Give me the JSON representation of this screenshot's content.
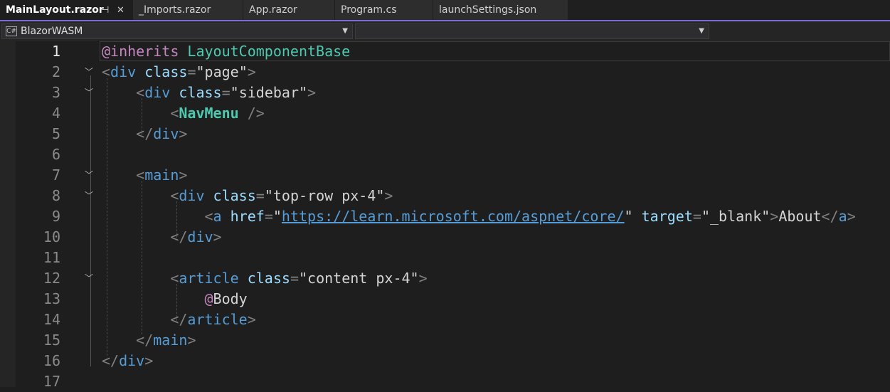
{
  "tabs": [
    {
      "label": "MainLayout.razor",
      "active": true
    },
    {
      "label": "_Imports.razor",
      "active": false
    },
    {
      "label": "App.razor",
      "active": false
    },
    {
      "label": "Program.cs",
      "active": false
    },
    {
      "label": "launchSettings.json",
      "active": false
    }
  ],
  "tab_icons": {
    "pin": "⊣",
    "close": "✕"
  },
  "navbar": {
    "project": "BlazorWASM",
    "project_icon": "C#",
    "member": ""
  },
  "editor": {
    "current_line": 1,
    "line_numbers": [
      "1",
      "2",
      "3",
      "4",
      "5",
      "6",
      "7",
      "8",
      "9",
      "10",
      "11",
      "12",
      "13",
      "14",
      "15",
      "16",
      "17"
    ],
    "lines": {
      "l1": {
        "directive": "@inherits",
        "type": "LayoutComponentBase"
      },
      "l2": {
        "tag": "div",
        "attr": "class",
        "value": "page"
      },
      "l3": {
        "tag": "div",
        "attr": "class",
        "value": "sidebar"
      },
      "l4": {
        "component": "NavMenu"
      },
      "l5": {
        "tag": "div"
      },
      "l7": {
        "tag": "main"
      },
      "l8": {
        "tag": "div",
        "attr": "class",
        "value": "top-row px-4"
      },
      "l9": {
        "tag": "a",
        "attr1": "href",
        "url": "https://learn.microsoft.com/aspnet/core/",
        "attr2": "target",
        "value2": "_blank",
        "text": "About"
      },
      "l10": {
        "tag": "div"
      },
      "l12": {
        "tag": "article",
        "attr": "class",
        "value": "content px-4"
      },
      "l13": {
        "at": "@",
        "expr": "Body"
      },
      "l14": {
        "tag": "article"
      },
      "l15": {
        "tag": "main"
      },
      "l16": {
        "tag": "div"
      }
    }
  },
  "colors": {
    "accent": "#7a6bd8",
    "background": "#1e1e1e",
    "tag": "#569cd6",
    "attribute": "#9cdcfe",
    "component": "#4ec9b0",
    "directive": "#c586c0"
  }
}
